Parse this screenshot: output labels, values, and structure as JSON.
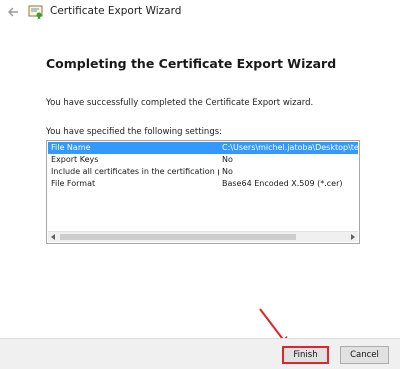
{
  "window": {
    "title": "Certificate Export Wizard"
  },
  "page": {
    "heading": "Completing the Certificate Export Wizard",
    "success_message": "You have successfully completed the Certificate Export wizard.",
    "settings_intro": "You have specified the following settings:"
  },
  "settings": [
    {
      "name": "File Name",
      "value": "C:\\Users\\michel.jatoba\\Desktop\\teste.cer",
      "selected": true
    },
    {
      "name": "Export Keys",
      "value": "No",
      "selected": false
    },
    {
      "name": "Include all certificates in the certification path",
      "value": "No",
      "selected": false
    },
    {
      "name": "File Format",
      "value": "Base64 Encoded X.509 (*.cer)",
      "selected": false
    }
  ],
  "buttons": {
    "finish": "Finish",
    "cancel": "Cancel"
  },
  "colors": {
    "selection": "#3399ff",
    "annotation": "#e0242d"
  },
  "icons": {
    "back": "back-arrow-icon",
    "certificate": "certificate-icon"
  }
}
